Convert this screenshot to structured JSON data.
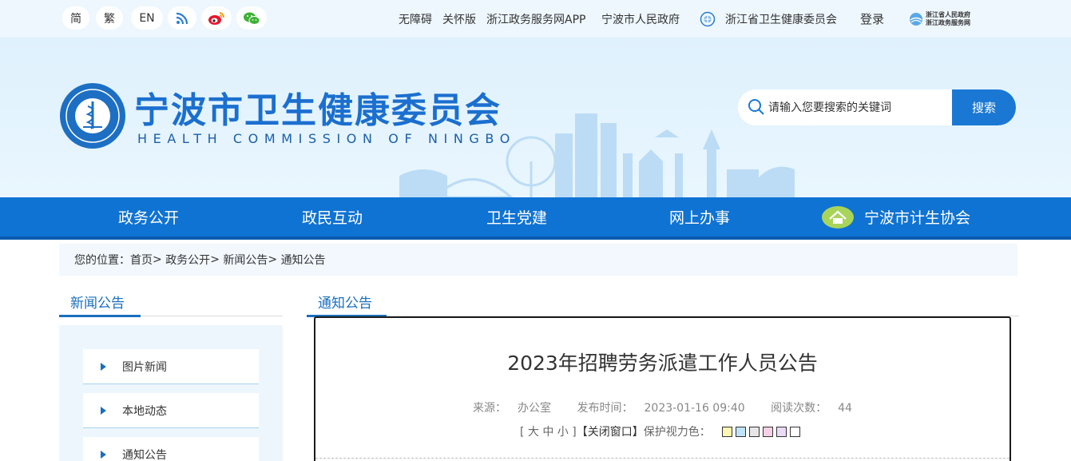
{
  "topbar": {
    "lang_simplified": "简",
    "lang_traditional": "繁",
    "lang_english": "EN",
    "links": {
      "accessibility": "无障碍",
      "elder_mode": "关怀版",
      "zj_app": "浙江政务服务网APP",
      "ningbo_gov": "宁波市人民政府",
      "zj_health": "浙江省卫生健康委员会",
      "login": "登录"
    },
    "badge": {
      "line1": "浙江省人民政府",
      "line2": "浙江政务服务网"
    }
  },
  "header": {
    "title_cn": "宁波市卫生健康委员会",
    "title_en": "HEALTH COMMISSION OF NINGBO",
    "search_placeholder": "请输入您要搜索的关键词",
    "search_button": "搜索"
  },
  "nav": {
    "items": [
      "政务公开",
      "政民互动",
      "卫生党建",
      "网上办事",
      "宁波市计生协会"
    ]
  },
  "breadcrumb": {
    "label": "您的位置：",
    "items": [
      "首页",
      "政务公开",
      "新闻公告",
      "通知公告"
    ],
    "sep": ">"
  },
  "sidebar": {
    "title": "新闻公告",
    "items": [
      "图片新闻",
      "本地动态",
      "通知公告"
    ]
  },
  "main": {
    "section_title": "通知公告",
    "article_title": "2023年招聘劳务派遣工作人员公告",
    "source_label": "来源：",
    "source": "办公室",
    "publish_label": "发布时间：",
    "publish_time": "2023-01-16 09:40",
    "views_label": "阅读次数：",
    "views": "44",
    "font_size_label": "[ 大 中 小 ]",
    "close_window": "【关闭窗口】",
    "eye_color_label": "保护视力色：",
    "eye_colors": [
      "#fdf7b1",
      "#bfe3f7",
      "#e6e6e6",
      "#f5d0e6",
      "#ead9f7",
      "#ffffff"
    ]
  },
  "colors": {
    "brand_blue": "#1a78d4",
    "nav_blue": "#0f73d3",
    "title_blue": "#1b6fcf"
  }
}
